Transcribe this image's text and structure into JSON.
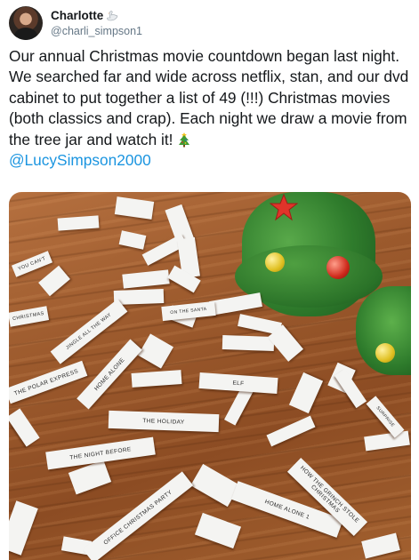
{
  "user": {
    "display_name": "Charlotte",
    "display_name_emoji": "swan-icon",
    "handle": "@charli_simpson1"
  },
  "tweet": {
    "text": "Our annual Christmas movie countdown began last night. We searched far and wide across netflix, stan, and our dvd cabinet to put together a list of 49 (!!!) Christmas movies (both classics and crap). Each night we draw a movie from the tree jar and watch it!",
    "text_emoji": "christmas-tree-icon",
    "mention": "@LucySimpson2000"
  },
  "colors": {
    "link": "#1b95e0",
    "handle_gray": "#657786",
    "text": "#14171a"
  },
  "photo": {
    "slips": [
      "YOU CAN'T",
      "HOW THE GRINCH STOLE CHRISTMAS",
      "THE POLAR EXPRESS",
      "HOME ALONE",
      "THE HOLIDAY",
      "THE NIGHT BEFORE",
      "OFFICE CHRISTMAS PARTY",
      "HOME ALONE 1",
      "ELF",
      "JINGLE ALL THE WAY",
      "CHRISTMAS",
      "ON THE SANTA",
      "SURPRISE"
    ]
  }
}
